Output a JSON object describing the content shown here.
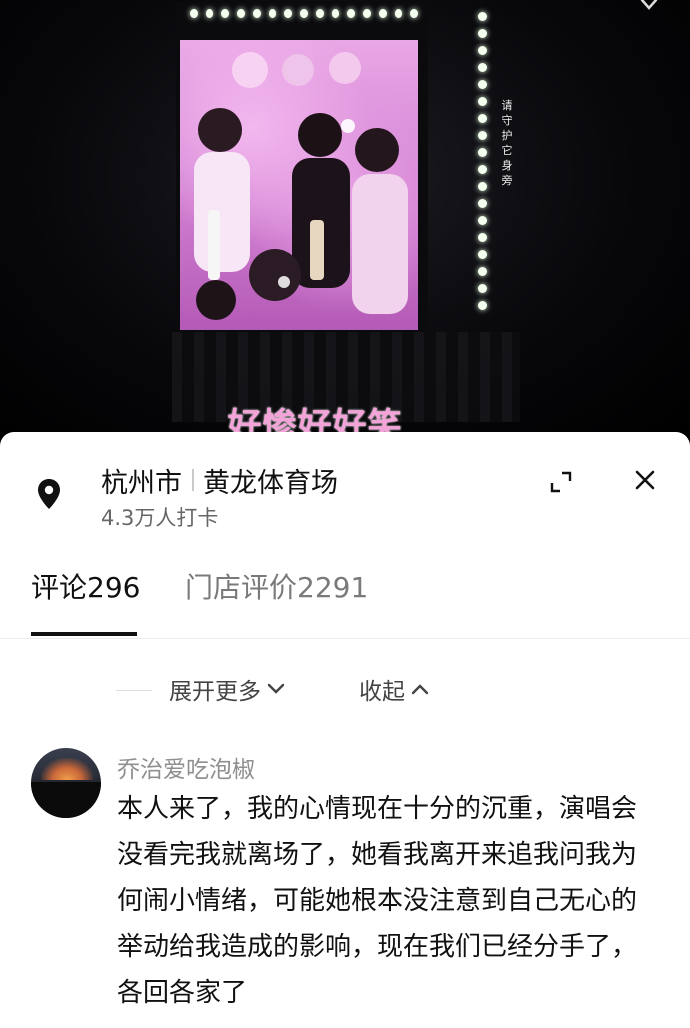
{
  "video": {
    "screen_side_text": "请守护它身旁",
    "caption": "好惨好好笑"
  },
  "location_sheet": {
    "city": "杭州市",
    "venue": "黄龙体育场",
    "checkins": "4.3万人打卡",
    "icons": {
      "location": "map-pin-icon",
      "expand": "expand-icon",
      "close": "close-icon"
    },
    "tabs": [
      {
        "label": "评论",
        "count": "296",
        "active": true
      },
      {
        "label": "门店评价",
        "count": "2291",
        "active": false
      }
    ]
  },
  "comments": {
    "expand_more_label": "展开更多",
    "collapse_label": "收起",
    "items": [
      {
        "username": "乔治爱吃泡椒",
        "text": "本人来了，我的心情现在十分的沉重，演唱会没看完我就离场了，她看我离开来追我问我为何闹小情绪，可能她根本没注意到自己无心的举动给我造成的影响，现在我们已经分手了，各回各家了"
      }
    ]
  },
  "colors": {
    "caption_pink": "#f3a3d7",
    "sheet_bg": "#ffffff",
    "tab_active": "#111111",
    "tab_inactive": "#7a7a7a",
    "username_gray": "#8f8f8f"
  }
}
